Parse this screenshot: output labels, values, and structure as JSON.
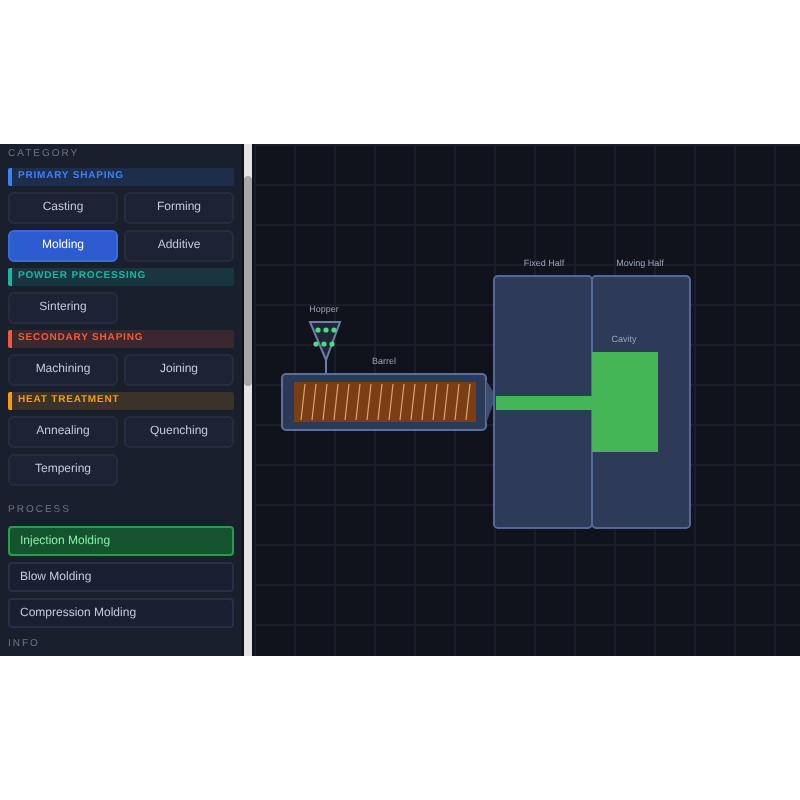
{
  "sidebar": {
    "category_label": "CATEGORY",
    "groups": [
      {
        "title": "PRIMARY SHAPING",
        "color": "#3b82f6",
        "items": [
          {
            "label": "Casting",
            "selected": false
          },
          {
            "label": "Forming",
            "selected": false
          },
          {
            "label": "Molding",
            "selected": true
          },
          {
            "label": "Additive",
            "selected": false
          }
        ]
      },
      {
        "title": "POWDER PROCESSING",
        "color": "#14b8a6",
        "items": [
          {
            "label": "Sintering",
            "selected": false
          }
        ]
      },
      {
        "title": "SECONDARY SHAPING",
        "color": "#ef5a3c",
        "items": [
          {
            "label": "Machining",
            "selected": false
          },
          {
            "label": "Joining",
            "selected": false
          }
        ]
      },
      {
        "title": "HEAT TREATMENT",
        "color": "#f59e0b",
        "items": [
          {
            "label": "Annealing",
            "selected": false
          },
          {
            "label": "Quenching",
            "selected": false
          },
          {
            "label": "Tempering",
            "selected": false
          }
        ]
      }
    ],
    "process_label": "PROCESS",
    "processes": [
      {
        "label": "Injection Molding",
        "selected": true
      },
      {
        "label": "Blow Molding",
        "selected": false
      },
      {
        "label": "Compression Molding",
        "selected": false
      }
    ],
    "info_label": "INFO"
  },
  "diagram": {
    "hopper": "Hopper",
    "barrel": "Barrel",
    "fixed_half": "Fixed Half",
    "moving_half": "Moving Half",
    "cavity": "Cavity"
  }
}
